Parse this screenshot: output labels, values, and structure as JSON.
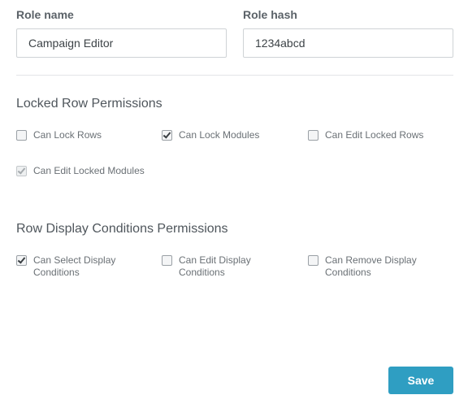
{
  "fields": {
    "role_name": {
      "label": "Role name",
      "value": "Campaign Editor"
    },
    "role_hash": {
      "label": "Role hash",
      "value": "1234abcd"
    }
  },
  "locked_rows": {
    "title": "Locked Row Permissions",
    "items": [
      {
        "label": "Can Lock Rows",
        "checked": false,
        "disabled": false
      },
      {
        "label": "Can Lock Modules",
        "checked": true,
        "disabled": false
      },
      {
        "label": "Can Edit Locked Rows",
        "checked": false,
        "disabled": false
      },
      {
        "label": "Can Edit Locked Modules",
        "checked": true,
        "disabled": true
      }
    ]
  },
  "display_conditions": {
    "title": "Row Display Conditions Permissions",
    "items": [
      {
        "label": "Can Select Display Conditions",
        "checked": true,
        "disabled": false
      },
      {
        "label": "Can Edit Display Conditions",
        "checked": false,
        "disabled": false
      },
      {
        "label": "Can Remove Display Conditions",
        "checked": false,
        "disabled": false
      }
    ]
  },
  "actions": {
    "save_label": "Save"
  },
  "colors": {
    "accent": "#2f9ec2"
  }
}
